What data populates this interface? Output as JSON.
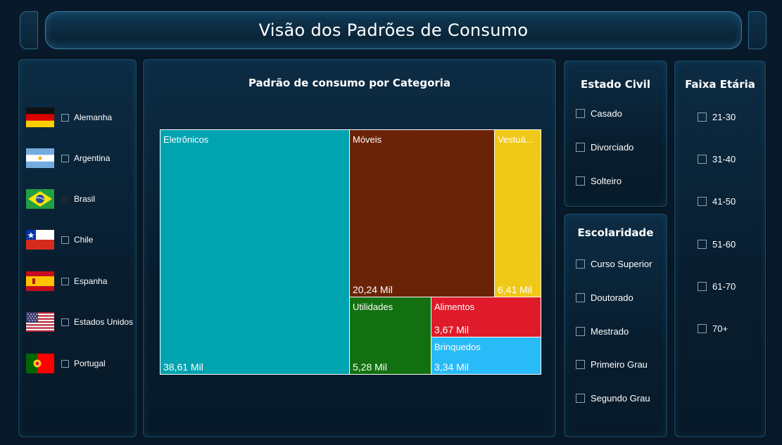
{
  "header": {
    "title": "Visão dos Padrões de Consumo"
  },
  "countries": [
    {
      "label": "Alemanha",
      "icon": "germany-flag-icon",
      "checked": false
    },
    {
      "label": "Argentina",
      "icon": "argentina-flag-icon",
      "checked": false
    },
    {
      "label": "Brasil",
      "icon": "brazil-flag-icon",
      "checked": false
    },
    {
      "label": "Chile",
      "icon": "chile-flag-icon",
      "checked": false
    },
    {
      "label": "Espanha",
      "icon": "spain-flag-icon",
      "checked": false
    },
    {
      "label": "Estados Unidos",
      "icon": "usa-flag-icon",
      "checked": false
    },
    {
      "label": "Portugal",
      "icon": "portugal-flag-icon",
      "checked": false
    }
  ],
  "main": {
    "title": "Padrão de consumo por Categoria"
  },
  "chart_data": {
    "type": "treemap",
    "title": "Padrão de consumo por Categoria",
    "items": [
      {
        "name": "Eletrônicos",
        "label": "Eletrônicos",
        "value": 38.61,
        "value_label": "38,61 Mil",
        "color": "#00a3b0"
      },
      {
        "name": "Móveis",
        "label": "Móveis",
        "value": 20.24,
        "value_label": "20,24 Mil",
        "color": "#6b2308"
      },
      {
        "name": "Vestuário",
        "label": "Vestuá...",
        "value": 6.41,
        "value_label": "6,41 Mil",
        "color": "#f0c818"
      },
      {
        "name": "Utilidades",
        "label": "Utilidades",
        "value": 5.28,
        "value_label": "5,28 Mil",
        "color": "#127010"
      },
      {
        "name": "Alimentos",
        "label": "Alimentos",
        "value": 3.67,
        "value_label": "3,67 Mil",
        "color": "#df1b2b"
      },
      {
        "name": "Brinquedos",
        "label": "Brinquedos",
        "value": 3.34,
        "value_label": "3,34 Mil",
        "color": "#29baf8"
      }
    ]
  },
  "estado_civil": {
    "title": "Estado Civil",
    "options": [
      "Casado",
      "Divorciado",
      "Solteiro"
    ]
  },
  "escolaridade": {
    "title": "Escolaridade",
    "options": [
      "Curso Superior",
      "Doutorado",
      "Mestrado",
      "Primeiro Grau",
      "Segundo Grau"
    ]
  },
  "faixa_etaria": {
    "title": "Faixa Etária",
    "options": [
      "21-30",
      "31-40",
      "41-50",
      "51-60",
      "61-70",
      "70+"
    ]
  }
}
